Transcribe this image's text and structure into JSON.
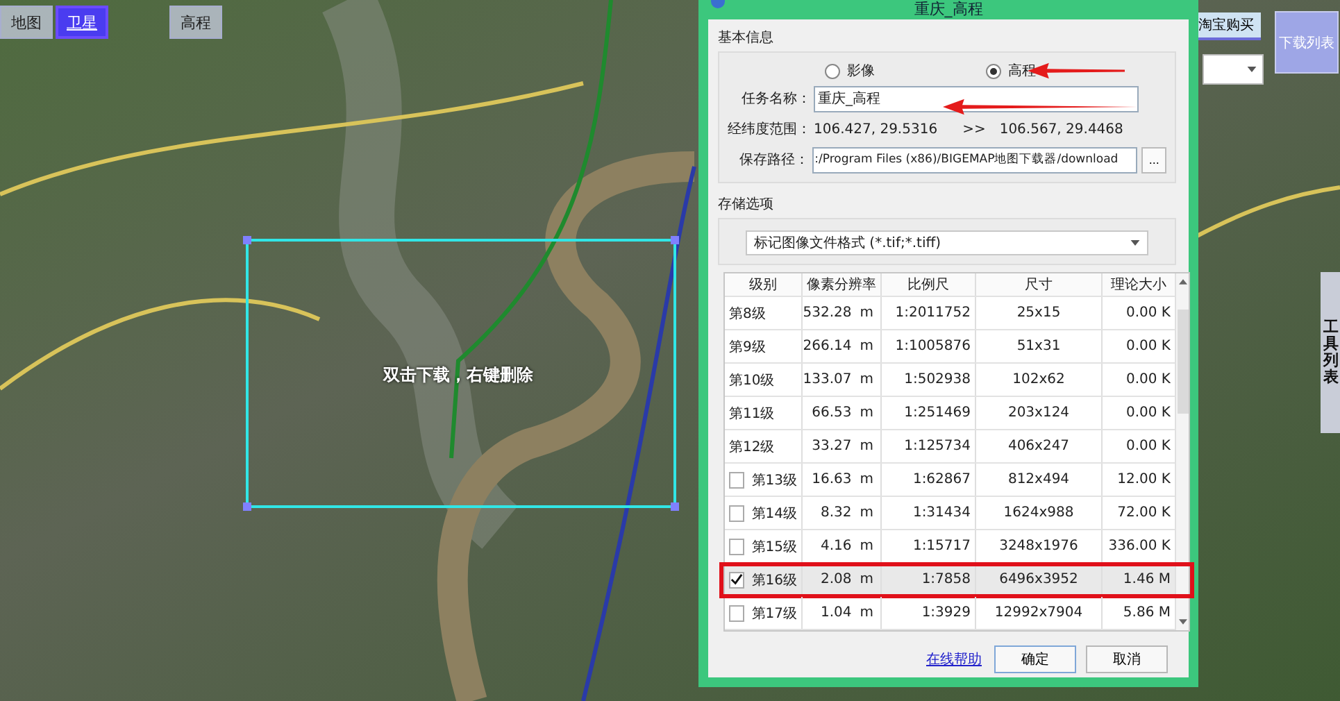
{
  "map_tabs": [
    {
      "label": "地图",
      "selected": false
    },
    {
      "label": "卫星",
      "selected": true
    },
    {
      "label": "高程",
      "selected": false
    }
  ],
  "buy_button": "淘宝购买",
  "download_list_button": "下载列表",
  "tool_panel": {
    "label": "工具列表"
  },
  "selection": {
    "hint": "双击下载，右键删除"
  },
  "dialog": {
    "title": "重庆_高程",
    "basic_section": "基本信息",
    "source_options": [
      {
        "label": "影像",
        "selected": false
      },
      {
        "label": "高程",
        "selected": true
      }
    ],
    "task_name_label": "任务名称：",
    "task_name": "重庆_高程",
    "range_label": "经纬度范围：",
    "range_start": "106.427, 29.5316",
    "range_separator": ">>",
    "range_end": "106.567, 29.4468",
    "path_label": "保存路径：",
    "path": ":/Program Files (x86)/BIGEMAP地图下载器/download",
    "browse_button": "...",
    "storage_section": "存储选项",
    "format": "标记图像文件格式 (*.tif;*.tiff)",
    "table": {
      "columns": [
        "级别",
        "像素分辨率",
        "比例尺",
        "尺寸",
        "理论大小"
      ],
      "rows": [
        {
          "kind": "plain",
          "level": "第8级",
          "resolution": "532.28",
          "unit": "m",
          "scale": "1:2011752",
          "size": "25x15",
          "file_size": "0.00 K"
        },
        {
          "kind": "plain",
          "level": "第9级",
          "resolution": "266.14",
          "unit": "m",
          "scale": "1:1005876",
          "size": "51x31",
          "file_size": "0.00 K"
        },
        {
          "kind": "plain",
          "level": "第10级",
          "resolution": "133.07",
          "unit": "m",
          "scale": "1:502938",
          "size": "102x62",
          "file_size": "0.00 K"
        },
        {
          "kind": "plain",
          "level": "第11级",
          "resolution": "66.53",
          "unit": "m",
          "scale": "1:251469",
          "size": "203x124",
          "file_size": "0.00 K"
        },
        {
          "kind": "plain",
          "level": "第12级",
          "resolution": "33.27",
          "unit": "m",
          "scale": "1:125734",
          "size": "406x247",
          "file_size": "0.00 K"
        },
        {
          "kind": "checkbox",
          "checked": false,
          "highlighted": false,
          "level": "第13级",
          "resolution": "16.63",
          "unit": "m",
          "scale": "1:62867",
          "size": "812x494",
          "file_size": "12.00 K"
        },
        {
          "kind": "checkbox",
          "checked": false,
          "highlighted": false,
          "level": "第14级",
          "resolution": "8.32",
          "unit": "m",
          "scale": "1:31434",
          "size": "1624x988",
          "file_size": "72.00 K"
        },
        {
          "kind": "checkbox",
          "checked": false,
          "highlighted": false,
          "level": "第15级",
          "resolution": "4.16",
          "unit": "m",
          "scale": "1:15717",
          "size": "3248x1976",
          "file_size": "336.00 K"
        },
        {
          "kind": "checkbox",
          "checked": true,
          "highlighted": true,
          "level": "第16级",
          "resolution": "2.08",
          "unit": "m",
          "scale": "1:7858",
          "size": "6496x3952",
          "file_size": "1.46 M"
        },
        {
          "kind": "checkbox",
          "checked": false,
          "highlighted": false,
          "level": "第17级",
          "resolution": "1.04",
          "unit": "m",
          "scale": "1:3929",
          "size": "12992x7904",
          "file_size": "5.86 M"
        }
      ]
    },
    "help_link": "在线帮助",
    "ok_button": "确定",
    "cancel_button": "取消"
  }
}
